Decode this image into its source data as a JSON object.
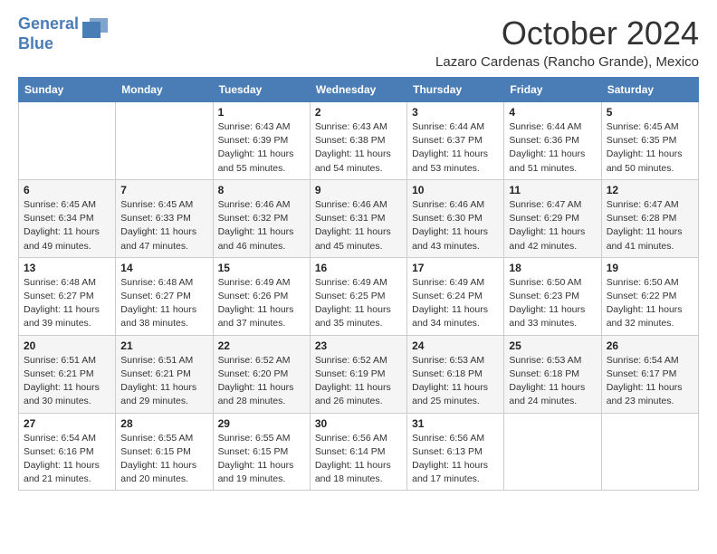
{
  "logo": {
    "line1": "General",
    "line2": "Blue"
  },
  "title": {
    "month": "October 2024",
    "location": "Lazaro Cardenas (Rancho Grande), Mexico"
  },
  "weekdays": [
    "Sunday",
    "Monday",
    "Tuesday",
    "Wednesday",
    "Thursday",
    "Friday",
    "Saturday"
  ],
  "weeks": [
    [
      {
        "day": "",
        "sunrise": "",
        "sunset": "",
        "daylight": ""
      },
      {
        "day": "",
        "sunrise": "",
        "sunset": "",
        "daylight": ""
      },
      {
        "day": "1",
        "sunrise": "Sunrise: 6:43 AM",
        "sunset": "Sunset: 6:39 PM",
        "daylight": "Daylight: 11 hours and 55 minutes."
      },
      {
        "day": "2",
        "sunrise": "Sunrise: 6:43 AM",
        "sunset": "Sunset: 6:38 PM",
        "daylight": "Daylight: 11 hours and 54 minutes."
      },
      {
        "day": "3",
        "sunrise": "Sunrise: 6:44 AM",
        "sunset": "Sunset: 6:37 PM",
        "daylight": "Daylight: 11 hours and 53 minutes."
      },
      {
        "day": "4",
        "sunrise": "Sunrise: 6:44 AM",
        "sunset": "Sunset: 6:36 PM",
        "daylight": "Daylight: 11 hours and 51 minutes."
      },
      {
        "day": "5",
        "sunrise": "Sunrise: 6:45 AM",
        "sunset": "Sunset: 6:35 PM",
        "daylight": "Daylight: 11 hours and 50 minutes."
      }
    ],
    [
      {
        "day": "6",
        "sunrise": "Sunrise: 6:45 AM",
        "sunset": "Sunset: 6:34 PM",
        "daylight": "Daylight: 11 hours and 49 minutes."
      },
      {
        "day": "7",
        "sunrise": "Sunrise: 6:45 AM",
        "sunset": "Sunset: 6:33 PM",
        "daylight": "Daylight: 11 hours and 47 minutes."
      },
      {
        "day": "8",
        "sunrise": "Sunrise: 6:46 AM",
        "sunset": "Sunset: 6:32 PM",
        "daylight": "Daylight: 11 hours and 46 minutes."
      },
      {
        "day": "9",
        "sunrise": "Sunrise: 6:46 AM",
        "sunset": "Sunset: 6:31 PM",
        "daylight": "Daylight: 11 hours and 45 minutes."
      },
      {
        "day": "10",
        "sunrise": "Sunrise: 6:46 AM",
        "sunset": "Sunset: 6:30 PM",
        "daylight": "Daylight: 11 hours and 43 minutes."
      },
      {
        "day": "11",
        "sunrise": "Sunrise: 6:47 AM",
        "sunset": "Sunset: 6:29 PM",
        "daylight": "Daylight: 11 hours and 42 minutes."
      },
      {
        "day": "12",
        "sunrise": "Sunrise: 6:47 AM",
        "sunset": "Sunset: 6:28 PM",
        "daylight": "Daylight: 11 hours and 41 minutes."
      }
    ],
    [
      {
        "day": "13",
        "sunrise": "Sunrise: 6:48 AM",
        "sunset": "Sunset: 6:27 PM",
        "daylight": "Daylight: 11 hours and 39 minutes."
      },
      {
        "day": "14",
        "sunrise": "Sunrise: 6:48 AM",
        "sunset": "Sunset: 6:27 PM",
        "daylight": "Daylight: 11 hours and 38 minutes."
      },
      {
        "day": "15",
        "sunrise": "Sunrise: 6:49 AM",
        "sunset": "Sunset: 6:26 PM",
        "daylight": "Daylight: 11 hours and 37 minutes."
      },
      {
        "day": "16",
        "sunrise": "Sunrise: 6:49 AM",
        "sunset": "Sunset: 6:25 PM",
        "daylight": "Daylight: 11 hours and 35 minutes."
      },
      {
        "day": "17",
        "sunrise": "Sunrise: 6:49 AM",
        "sunset": "Sunset: 6:24 PM",
        "daylight": "Daylight: 11 hours and 34 minutes."
      },
      {
        "day": "18",
        "sunrise": "Sunrise: 6:50 AM",
        "sunset": "Sunset: 6:23 PM",
        "daylight": "Daylight: 11 hours and 33 minutes."
      },
      {
        "day": "19",
        "sunrise": "Sunrise: 6:50 AM",
        "sunset": "Sunset: 6:22 PM",
        "daylight": "Daylight: 11 hours and 32 minutes."
      }
    ],
    [
      {
        "day": "20",
        "sunrise": "Sunrise: 6:51 AM",
        "sunset": "Sunset: 6:21 PM",
        "daylight": "Daylight: 11 hours and 30 minutes."
      },
      {
        "day": "21",
        "sunrise": "Sunrise: 6:51 AM",
        "sunset": "Sunset: 6:21 PM",
        "daylight": "Daylight: 11 hours and 29 minutes."
      },
      {
        "day": "22",
        "sunrise": "Sunrise: 6:52 AM",
        "sunset": "Sunset: 6:20 PM",
        "daylight": "Daylight: 11 hours and 28 minutes."
      },
      {
        "day": "23",
        "sunrise": "Sunrise: 6:52 AM",
        "sunset": "Sunset: 6:19 PM",
        "daylight": "Daylight: 11 hours and 26 minutes."
      },
      {
        "day": "24",
        "sunrise": "Sunrise: 6:53 AM",
        "sunset": "Sunset: 6:18 PM",
        "daylight": "Daylight: 11 hours and 25 minutes."
      },
      {
        "day": "25",
        "sunrise": "Sunrise: 6:53 AM",
        "sunset": "Sunset: 6:18 PM",
        "daylight": "Daylight: 11 hours and 24 minutes."
      },
      {
        "day": "26",
        "sunrise": "Sunrise: 6:54 AM",
        "sunset": "Sunset: 6:17 PM",
        "daylight": "Daylight: 11 hours and 23 minutes."
      }
    ],
    [
      {
        "day": "27",
        "sunrise": "Sunrise: 6:54 AM",
        "sunset": "Sunset: 6:16 PM",
        "daylight": "Daylight: 11 hours and 21 minutes."
      },
      {
        "day": "28",
        "sunrise": "Sunrise: 6:55 AM",
        "sunset": "Sunset: 6:15 PM",
        "daylight": "Daylight: 11 hours and 20 minutes."
      },
      {
        "day": "29",
        "sunrise": "Sunrise: 6:55 AM",
        "sunset": "Sunset: 6:15 PM",
        "daylight": "Daylight: 11 hours and 19 minutes."
      },
      {
        "day": "30",
        "sunrise": "Sunrise: 6:56 AM",
        "sunset": "Sunset: 6:14 PM",
        "daylight": "Daylight: 11 hours and 18 minutes."
      },
      {
        "day": "31",
        "sunrise": "Sunrise: 6:56 AM",
        "sunset": "Sunset: 6:13 PM",
        "daylight": "Daylight: 11 hours and 17 minutes."
      },
      {
        "day": "",
        "sunrise": "",
        "sunset": "",
        "daylight": ""
      },
      {
        "day": "",
        "sunrise": "",
        "sunset": "",
        "daylight": ""
      }
    ]
  ]
}
